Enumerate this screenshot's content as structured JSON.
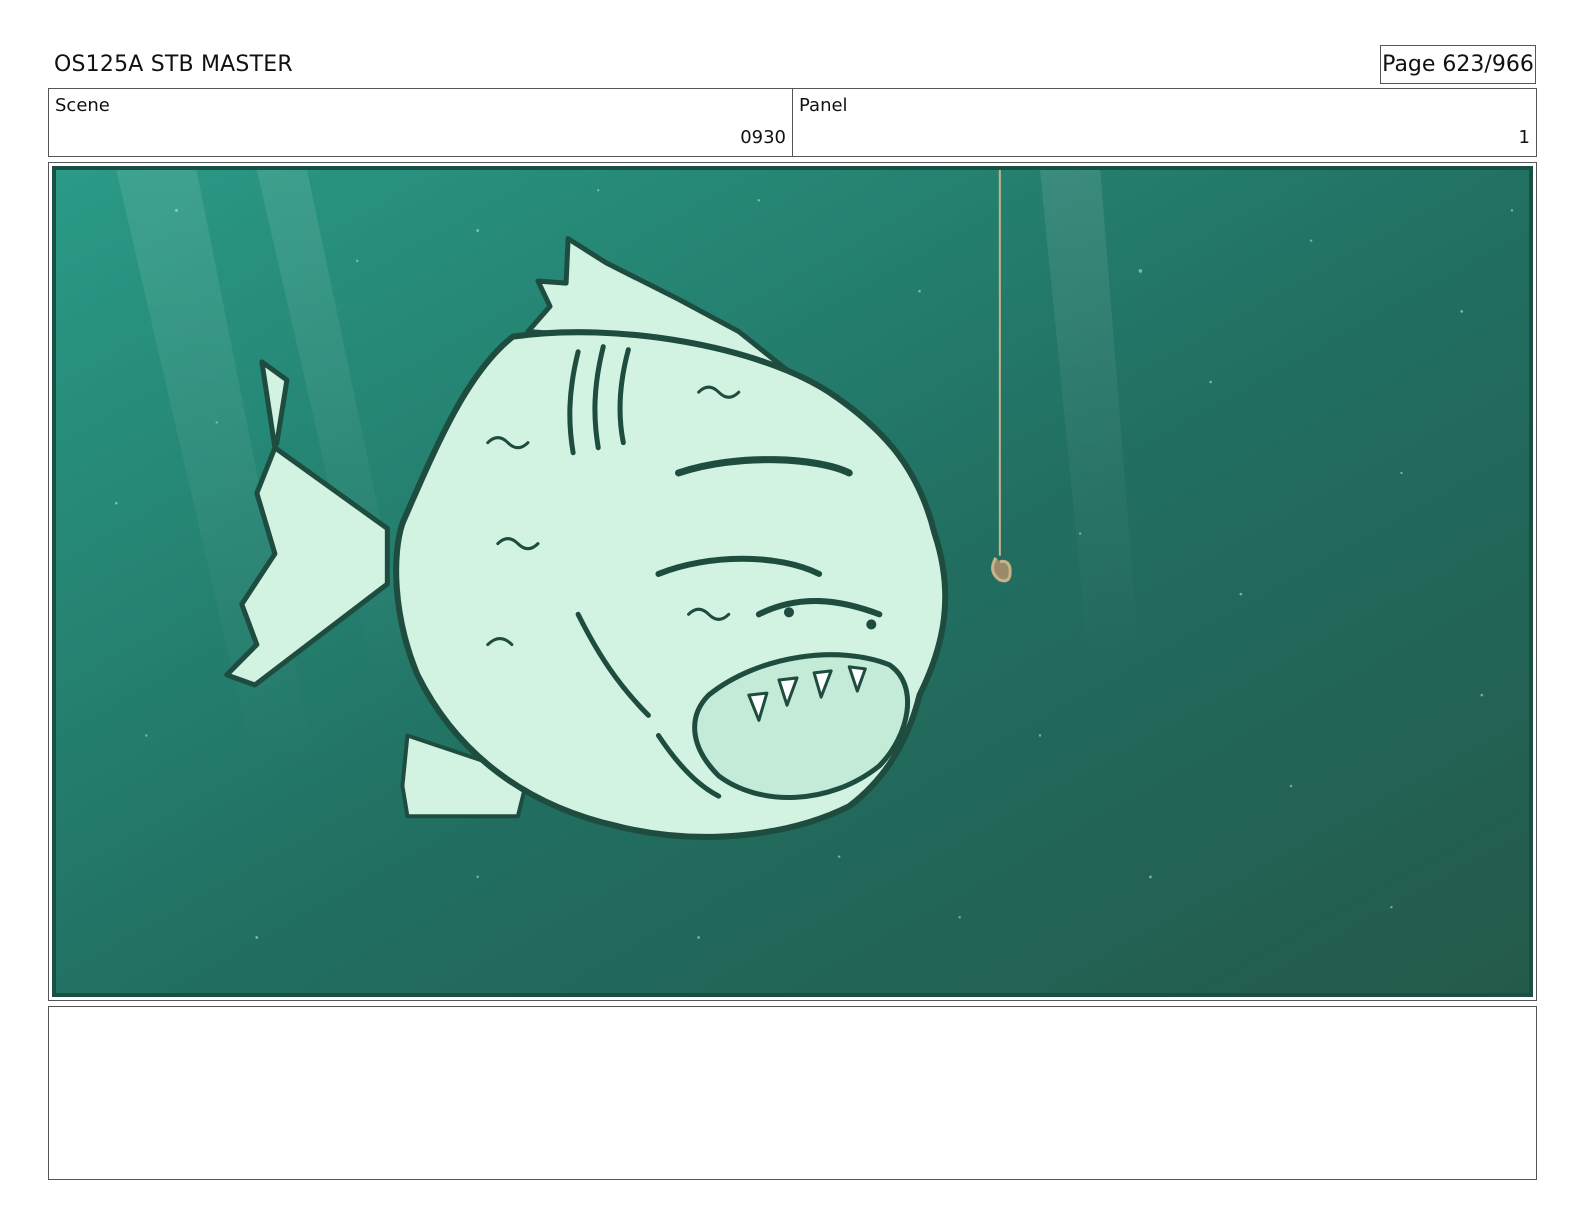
{
  "header": {
    "doc_title": "OS125A STB MASTER",
    "page_label": "Page 623/966"
  },
  "info": {
    "scene_label": "Scene",
    "scene_value": "0930",
    "panel_label": "Panel",
    "panel_value": "1"
  },
  "colors": {
    "water_top": "#2a9a86",
    "water_bottom": "#245a4c",
    "fish_fill": "#d2f2e2",
    "ink": "#1e4d40",
    "line": "#c7b38a"
  },
  "notes": {
    "text": ""
  }
}
